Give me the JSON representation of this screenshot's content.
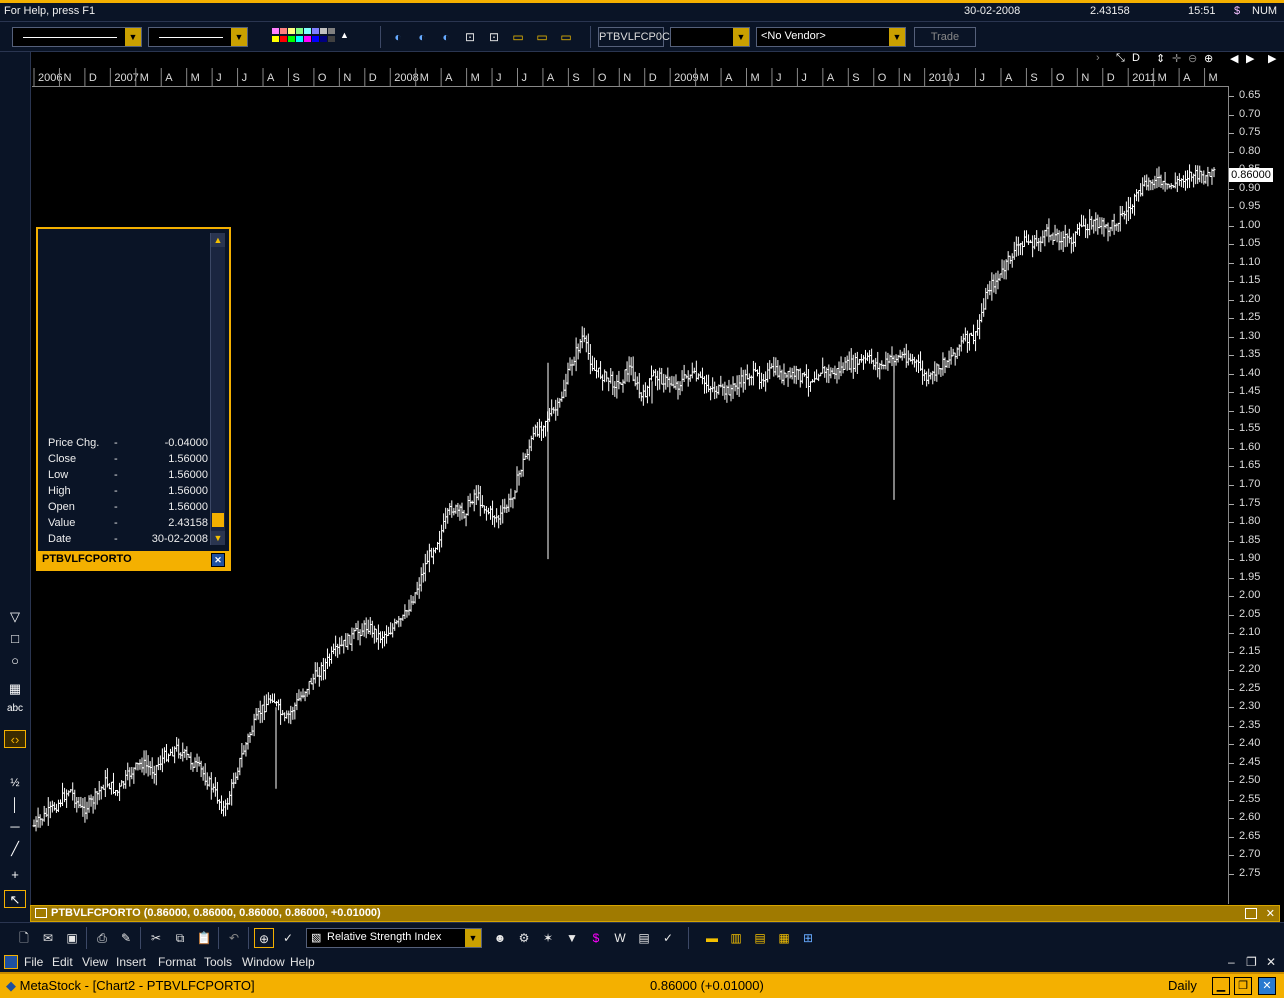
{
  "status": {
    "help_text": "For Help, press F1",
    "date": "30-02-2008",
    "value": "2.43158",
    "time": "15:51",
    "num": "NUM"
  },
  "format_toolbar": {
    "security_box": "PTBVLFCP0C",
    "vendor_select": "<No Vendor>",
    "trade_button": "Trade"
  },
  "chart_window": {
    "caption_title": "PTBVLFCPORTO",
    "caption_values": "(0.86000, 0.86000, 0.86000, 0.86000, +0.01000)",
    "last_price_label": "0.86000"
  },
  "data_window": {
    "title": "PTBVLFCPORTO",
    "rows": [
      {
        "key": "Price Chg.",
        "dash": "-",
        "val": "-0.04000"
      },
      {
        "key": "Close",
        "dash": "-",
        "val": "1.56000"
      },
      {
        "key": "Low",
        "dash": "-",
        "val": "1.56000"
      },
      {
        "key": "High",
        "dash": "-",
        "val": "1.56000"
      },
      {
        "key": "Open",
        "dash": "-",
        "val": "1.56000"
      },
      {
        "key": "Value",
        "dash": "-",
        "val": "2.43158"
      },
      {
        "key": "Date",
        "dash": "-",
        "val": "30-02-2008"
      }
    ]
  },
  "left_tools": {
    "text_tool": "abc"
  },
  "std_toolbar": {
    "indicator_select": "Relative Strength Index"
  },
  "menu": {
    "items": [
      "File",
      "Edit",
      "View",
      "Insert",
      "Format",
      "Tools",
      "Window",
      "Help"
    ]
  },
  "titlebar": {
    "app_title": "MetaStock - [Chart2 - PTBVLFCPORTO]",
    "quote": "0.86000 (+0.01000)",
    "periodicity": "Daily"
  },
  "colors": {
    "accent": "#f4b000",
    "panel": "#0a1426",
    "chart_bg": "#000000",
    "price_bars": "#ffffff"
  },
  "chart_data": {
    "type": "bar",
    "x_tick_labels": [
      "2006",
      "N",
      "D",
      "2007",
      "M",
      "A",
      "M",
      "J",
      "J",
      "A",
      "S",
      "O",
      "N",
      "D",
      "2008",
      "M",
      "A",
      "M",
      "J",
      "J",
      "A",
      "S",
      "O",
      "N",
      "D",
      "2009",
      "M",
      "A",
      "M",
      "J",
      "J",
      "A",
      "S",
      "O",
      "N",
      "2010",
      "J",
      "J",
      "A",
      "S",
      "O",
      "N",
      "D",
      "2011",
      "M",
      "A",
      "M"
    ],
    "y_tick_labels": [
      "0.65",
      "0.70",
      "0.75",
      "0.80",
      "0.85",
      "0.90",
      "0.95",
      "1.00",
      "1.05",
      "1.10",
      "1.15",
      "1.20",
      "1.25",
      "1.30",
      "1.35",
      "1.40",
      "1.45",
      "1.50",
      "1.55",
      "1.60",
      "1.65",
      "1.70",
      "1.75",
      "1.80",
      "1.85",
      "1.90",
      "1.95",
      "2.00",
      "2.05",
      "2.10",
      "2.15",
      "2.20",
      "2.25",
      "2.30",
      "2.35",
      "2.40",
      "2.45",
      "2.50",
      "2.55",
      "2.60",
      "2.65",
      "2.70",
      "2.75"
    ],
    "y_axis_inverted": true,
    "ylim": [
      0.65,
      2.75
    ],
    "series": [
      {
        "values": [
          2.62,
          2.59,
          2.56,
          2.52,
          2.58,
          2.55,
          2.5,
          2.53,
          2.48,
          2.45,
          2.47,
          2.43,
          2.41,
          2.44,
          2.47,
          2.52,
          2.58,
          2.47,
          2.38,
          2.31,
          2.27,
          2.34,
          2.29,
          2.24,
          2.2,
          2.16,
          2.13,
          2.1,
          2.08,
          2.11,
          2.09,
          2.06,
          1.99,
          1.9,
          1.84,
          1.76,
          1.78,
          1.72,
          1.77,
          1.79,
          1.74,
          1.64,
          1.56,
          1.52,
          1.49,
          1.38,
          1.3,
          1.39,
          1.41,
          1.43,
          1.38,
          1.47,
          1.4,
          1.42,
          1.43,
          1.4,
          1.42,
          1.44,
          1.45,
          1.43,
          1.4,
          1.41,
          1.39,
          1.41,
          1.4,
          1.42,
          1.39,
          1.4,
          1.38,
          1.37,
          1.36,
          1.38,
          1.36,
          1.35,
          1.37,
          1.42,
          1.38,
          1.35,
          1.31,
          1.3,
          1.17,
          1.14,
          1.08,
          1.04,
          1.05,
          1.02,
          1.03,
          1.04,
          1.0,
          0.99,
          1.01,
          0.98,
          0.95,
          0.9,
          0.87,
          0.9,
          0.88,
          0.86,
          0.87,
          0.86
        ]
      }
    ]
  }
}
